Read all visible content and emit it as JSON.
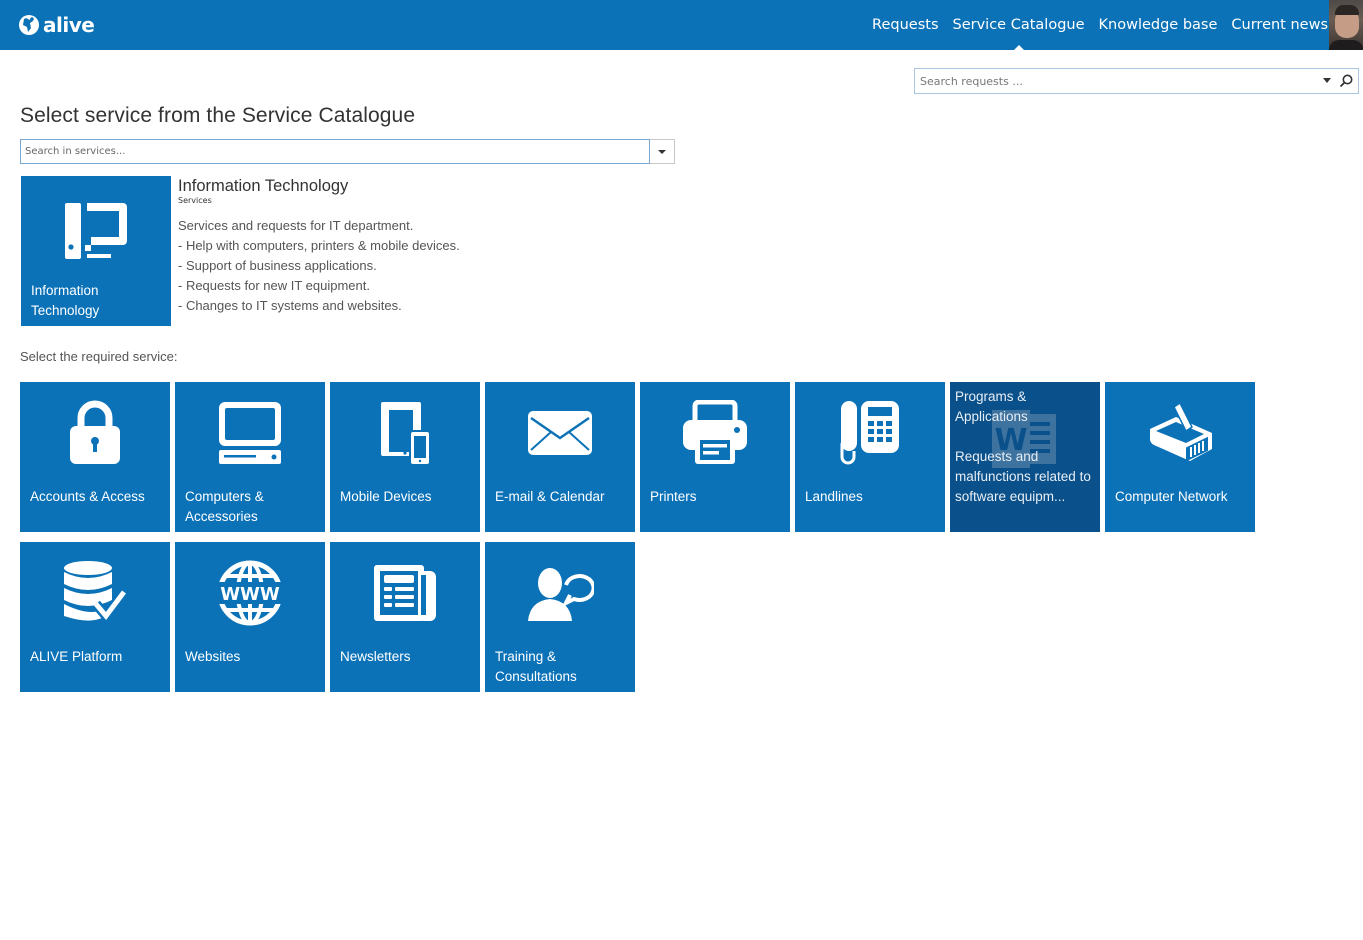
{
  "header": {
    "logo_text": "alive",
    "nav": [
      {
        "label": "Requests",
        "active": false
      },
      {
        "label": "Service Catalogue",
        "active": true
      },
      {
        "label": "Knowledge base",
        "active": false
      },
      {
        "label": "Current news",
        "active": false
      }
    ]
  },
  "request_search": {
    "placeholder": "Search requests ..."
  },
  "page": {
    "title": "Select service from the Service Catalogue",
    "service_search_placeholder": "Search in services...",
    "select_label": "Select the required service:"
  },
  "category": {
    "tile_label_line1": "Information",
    "tile_label_line2": "Technology",
    "title": "Information Technology",
    "subtitle": "Services",
    "description": [
      "Services and requests for IT department.",
      "- Help with computers, printers & mobile devices.",
      "- Support of business applications.",
      "- Requests for new IT equipment.",
      "- Changes to IT systems and websites."
    ]
  },
  "services": [
    {
      "label": "Accounts & Access",
      "icon": "lock-icon"
    },
    {
      "label": "Computers & Accessories",
      "icon": "computer-icon"
    },
    {
      "label": "Mobile Devices",
      "icon": "mobile-devices-icon"
    },
    {
      "label": "E-mail & Calendar",
      "icon": "envelope-icon"
    },
    {
      "label": "Printers",
      "icon": "printer-icon"
    },
    {
      "label": "Landlines",
      "icon": "phone-icon"
    },
    {
      "label": "Programs & Applications",
      "icon": "word-document-icon",
      "hover_description": "Requests and malfunctions related to software equipm...",
      "highlighted": true
    },
    {
      "label": "Computer Network",
      "icon": "network-cable-icon"
    },
    {
      "label": "ALIVE Platform",
      "icon": "database-check-icon"
    },
    {
      "label": "Websites",
      "icon": "www-globe-icon"
    },
    {
      "label": "Newsletters",
      "icon": "newspaper-icon"
    },
    {
      "label": "Training & Consultations",
      "icon": "person-speech-icon"
    }
  ],
  "colors": {
    "brand_blue": "#0b72b8",
    "tile_selected": "#0a508a"
  }
}
